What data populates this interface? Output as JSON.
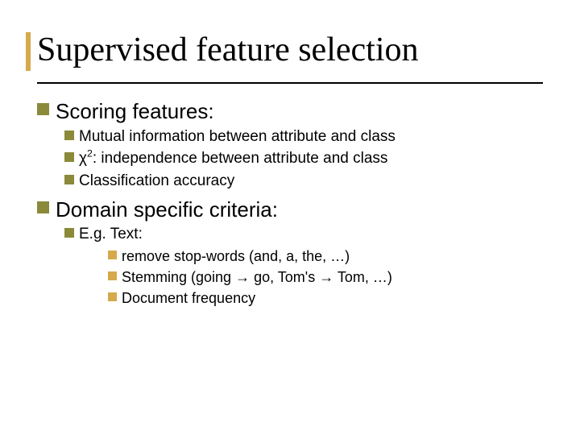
{
  "title": "Supervised feature selection",
  "l1": [
    {
      "text": "Scoring features:"
    },
    {
      "text": "Domain specific criteria:"
    }
  ],
  "scoring": [
    {
      "text": "Mutual information between attribute and class"
    },
    {
      "prefix": "χ",
      "sup": "2",
      "suffix": ": independence between attribute and class"
    },
    {
      "text": "Classification accuracy"
    }
  ],
  "domain_l2": [
    {
      "text": "E.g. Text:"
    }
  ],
  "text_l3": [
    {
      "text": "remove stop-words (and, a, the, …)"
    },
    {
      "text": "Stemming (going → go, Tom's → Tom, …)"
    },
    {
      "text": "Document frequency"
    }
  ]
}
